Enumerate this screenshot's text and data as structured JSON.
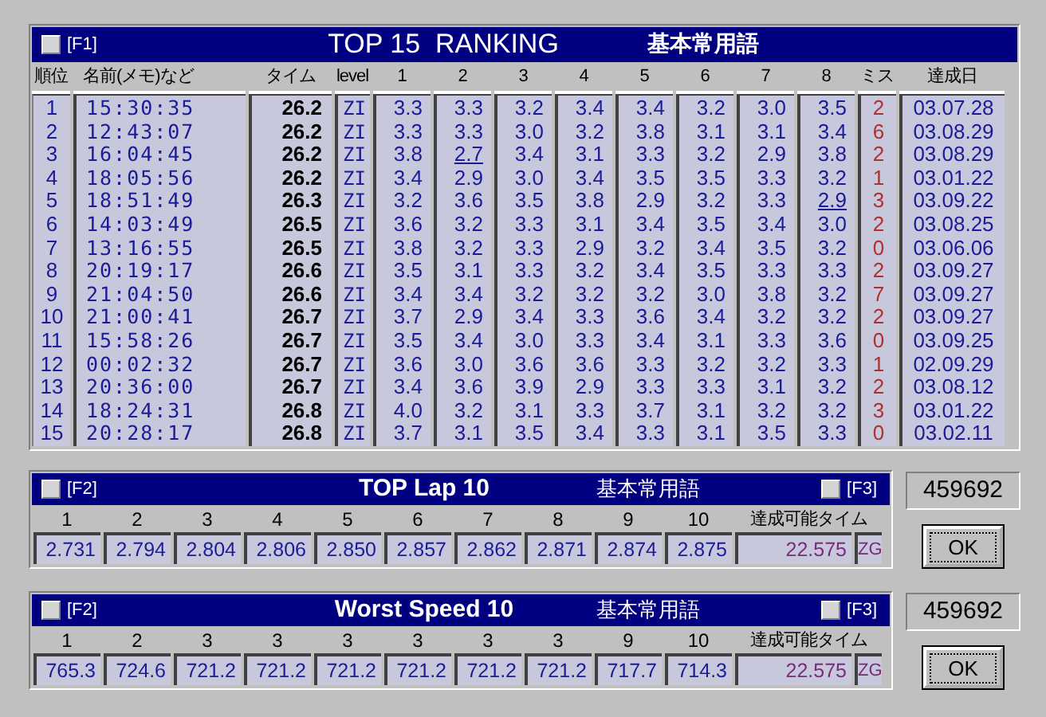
{
  "ranking": {
    "key": "[F1]",
    "title": "TOP 15  RANKING",
    "subtitle": "基本常用語",
    "columns": [
      "順位",
      "名前(メモ)など",
      "タイム",
      "level",
      "1",
      "2",
      "3",
      "4",
      "5",
      "6",
      "7",
      "8",
      "ミス",
      "達成日"
    ],
    "rows": [
      {
        "rank": "1",
        "name": "15:30:35",
        "time": "26.2",
        "level": "ZI",
        "laps": [
          {
            "t": "3.3",
            "best": false
          },
          {
            "t": "3.3",
            "best": false
          },
          {
            "t": "3.2",
            "best": false
          },
          {
            "t": "3.4",
            "best": false
          },
          {
            "t": "3.4",
            "best": false
          },
          {
            "t": "3.2",
            "best": false
          },
          {
            "t": "3.0",
            "best": false
          },
          {
            "t": "3.5",
            "best": false
          }
        ],
        "misses": "2",
        "date": "03.07.28"
      },
      {
        "rank": "2",
        "name": "12:43:07",
        "time": "26.2",
        "level": "ZI",
        "laps": [
          {
            "t": "3.3",
            "best": false
          },
          {
            "t": "3.3",
            "best": false
          },
          {
            "t": "3.0",
            "best": false
          },
          {
            "t": "3.2",
            "best": false
          },
          {
            "t": "3.8",
            "best": false
          },
          {
            "t": "3.1",
            "best": false
          },
          {
            "t": "3.1",
            "best": false
          },
          {
            "t": "3.4",
            "best": false
          }
        ],
        "misses": "6",
        "date": "03.08.29"
      },
      {
        "rank": "3",
        "name": "16:04:45",
        "time": "26.2",
        "level": "ZI",
        "laps": [
          {
            "t": "3.8",
            "best": false
          },
          {
            "t": "2.7",
            "best": true
          },
          {
            "t": "3.4",
            "best": false
          },
          {
            "t": "3.1",
            "best": false
          },
          {
            "t": "3.3",
            "best": false
          },
          {
            "t": "3.2",
            "best": false
          },
          {
            "t": "2.9",
            "best": false
          },
          {
            "t": "3.8",
            "best": false
          }
        ],
        "misses": "2",
        "date": "03.08.29"
      },
      {
        "rank": "4",
        "name": "18:05:56",
        "time": "26.2",
        "level": "ZI",
        "laps": [
          {
            "t": "3.4",
            "best": false
          },
          {
            "t": "2.9",
            "best": false
          },
          {
            "t": "3.0",
            "best": false
          },
          {
            "t": "3.4",
            "best": false
          },
          {
            "t": "3.5",
            "best": false
          },
          {
            "t": "3.5",
            "best": false
          },
          {
            "t": "3.3",
            "best": false
          },
          {
            "t": "3.2",
            "best": false
          }
        ],
        "misses": "1",
        "date": "03.01.22"
      },
      {
        "rank": "5",
        "name": "18:51:49",
        "time": "26.3",
        "level": "ZI",
        "laps": [
          {
            "t": "3.2",
            "best": false
          },
          {
            "t": "3.6",
            "best": false
          },
          {
            "t": "3.5",
            "best": false
          },
          {
            "t": "3.8",
            "best": false
          },
          {
            "t": "2.9",
            "best": false
          },
          {
            "t": "3.2",
            "best": false
          },
          {
            "t": "3.3",
            "best": false
          },
          {
            "t": "2.9",
            "best": true
          }
        ],
        "misses": "3",
        "date": "03.09.22"
      },
      {
        "rank": "6",
        "name": "14:03:49",
        "time": "26.5",
        "level": "ZI",
        "laps": [
          {
            "t": "3.6",
            "best": false
          },
          {
            "t": "3.2",
            "best": false
          },
          {
            "t": "3.3",
            "best": false
          },
          {
            "t": "3.1",
            "best": false
          },
          {
            "t": "3.4",
            "best": false
          },
          {
            "t": "3.5",
            "best": false
          },
          {
            "t": "3.4",
            "best": false
          },
          {
            "t": "3.0",
            "best": false
          }
        ],
        "misses": "2",
        "date": "03.08.25"
      },
      {
        "rank": "7",
        "name": "13:16:55",
        "time": "26.5",
        "level": "ZI",
        "laps": [
          {
            "t": "3.8",
            "best": false
          },
          {
            "t": "3.2",
            "best": false
          },
          {
            "t": "3.3",
            "best": false
          },
          {
            "t": "2.9",
            "best": false
          },
          {
            "t": "3.2",
            "best": false
          },
          {
            "t": "3.4",
            "best": false
          },
          {
            "t": "3.5",
            "best": false
          },
          {
            "t": "3.2",
            "best": false
          }
        ],
        "misses": "0",
        "date": "03.06.06"
      },
      {
        "rank": "8",
        "name": "20:19:17",
        "time": "26.6",
        "level": "ZI",
        "laps": [
          {
            "t": "3.5",
            "best": false
          },
          {
            "t": "3.1",
            "best": false
          },
          {
            "t": "3.3",
            "best": false
          },
          {
            "t": "3.2",
            "best": false
          },
          {
            "t": "3.4",
            "best": false
          },
          {
            "t": "3.5",
            "best": false
          },
          {
            "t": "3.3",
            "best": false
          },
          {
            "t": "3.3",
            "best": false
          }
        ],
        "misses": "2",
        "date": "03.09.27"
      },
      {
        "rank": "9",
        "name": "21:04:50",
        "time": "26.6",
        "level": "ZI",
        "laps": [
          {
            "t": "3.4",
            "best": false
          },
          {
            "t": "3.4",
            "best": false
          },
          {
            "t": "3.2",
            "best": false
          },
          {
            "t": "3.2",
            "best": false
          },
          {
            "t": "3.2",
            "best": false
          },
          {
            "t": "3.0",
            "best": false
          },
          {
            "t": "3.8",
            "best": false
          },
          {
            "t": "3.2",
            "best": false
          }
        ],
        "misses": "7",
        "date": "03.09.27"
      },
      {
        "rank": "10",
        "name": "21:00:41",
        "time": "26.7",
        "level": "ZI",
        "laps": [
          {
            "t": "3.7",
            "best": false
          },
          {
            "t": "2.9",
            "best": false
          },
          {
            "t": "3.4",
            "best": false
          },
          {
            "t": "3.3",
            "best": false
          },
          {
            "t": "3.6",
            "best": false
          },
          {
            "t": "3.4",
            "best": false
          },
          {
            "t": "3.2",
            "best": false
          },
          {
            "t": "3.2",
            "best": false
          }
        ],
        "misses": "2",
        "date": "03.09.27"
      },
      {
        "rank": "11",
        "name": "15:58:26",
        "time": "26.7",
        "level": "ZI",
        "laps": [
          {
            "t": "3.5",
            "best": false
          },
          {
            "t": "3.4",
            "best": false
          },
          {
            "t": "3.0",
            "best": false
          },
          {
            "t": "3.3",
            "best": false
          },
          {
            "t": "3.4",
            "best": false
          },
          {
            "t": "3.1",
            "best": false
          },
          {
            "t": "3.3",
            "best": false
          },
          {
            "t": "3.6",
            "best": false
          }
        ],
        "misses": "0",
        "date": "03.09.25"
      },
      {
        "rank": "12",
        "name": "00:02:32",
        "time": "26.7",
        "level": "ZI",
        "laps": [
          {
            "t": "3.6",
            "best": false
          },
          {
            "t": "3.0",
            "best": false
          },
          {
            "t": "3.6",
            "best": false
          },
          {
            "t": "3.6",
            "best": false
          },
          {
            "t": "3.3",
            "best": false
          },
          {
            "t": "3.2",
            "best": false
          },
          {
            "t": "3.2",
            "best": false
          },
          {
            "t": "3.3",
            "best": false
          }
        ],
        "misses": "1",
        "date": "02.09.29"
      },
      {
        "rank": "13",
        "name": "20:36:00",
        "time": "26.7",
        "level": "ZI",
        "laps": [
          {
            "t": "3.4",
            "best": false
          },
          {
            "t": "3.6",
            "best": false
          },
          {
            "t": "3.9",
            "best": false
          },
          {
            "t": "2.9",
            "best": false
          },
          {
            "t": "3.3",
            "best": false
          },
          {
            "t": "3.3",
            "best": false
          },
          {
            "t": "3.1",
            "best": false
          },
          {
            "t": "3.2",
            "best": false
          }
        ],
        "misses": "2",
        "date": "03.08.12"
      },
      {
        "rank": "14",
        "name": "18:24:31",
        "time": "26.8",
        "level": "ZI",
        "laps": [
          {
            "t": "4.0",
            "best": false
          },
          {
            "t": "3.2",
            "best": false
          },
          {
            "t": "3.1",
            "best": false
          },
          {
            "t": "3.3",
            "best": false
          },
          {
            "t": "3.7",
            "best": false
          },
          {
            "t": "3.1",
            "best": false
          },
          {
            "t": "3.2",
            "best": false
          },
          {
            "t": "3.2",
            "best": false
          }
        ],
        "misses": "3",
        "date": "03.01.22"
      },
      {
        "rank": "15",
        "name": "20:28:17",
        "time": "26.8",
        "level": "ZI",
        "laps": [
          {
            "t": "3.7",
            "best": false
          },
          {
            "t": "3.1",
            "best": false
          },
          {
            "t": "3.5",
            "best": false
          },
          {
            "t": "3.4",
            "best": false
          },
          {
            "t": "3.3",
            "best": false
          },
          {
            "t": "3.1",
            "best": false
          },
          {
            "t": "3.5",
            "best": false
          },
          {
            "t": "3.3",
            "best": false
          }
        ],
        "misses": "0",
        "date": "03.02.11"
      }
    ]
  },
  "panels": [
    {
      "key_left": "[F2]",
      "title": "TOP Lap 10",
      "subtitle": "基本常用語",
      "key_right": "[F3]",
      "columns": [
        "1",
        "2",
        "3",
        "4",
        "5",
        "6",
        "7",
        "8",
        "9",
        "10",
        "達成可能タイム"
      ],
      "values": [
        "2.731",
        "2.794",
        "2.804",
        "2.806",
        "2.850",
        "2.857",
        "2.862",
        "2.871",
        "2.874",
        "2.875"
      ],
      "target_time": "22.575",
      "target_level": "ZG",
      "score": "459692",
      "button": "OK"
    },
    {
      "key_left": "[F2]",
      "title": "Worst Speed 10",
      "subtitle": "基本常用語",
      "key_right": "[F3]",
      "columns": [
        "1",
        "2",
        "3",
        "3",
        "3",
        "3",
        "3",
        "3",
        "9",
        "10",
        "達成可能タイム"
      ],
      "values": [
        "765.3",
        "724.6",
        "721.2",
        "721.2",
        "721.2",
        "721.2",
        "721.2",
        "721.2",
        "717.7",
        "714.3"
      ],
      "target_time": "22.575",
      "target_level": "ZG",
      "score": "459692",
      "button": "OK"
    }
  ]
}
